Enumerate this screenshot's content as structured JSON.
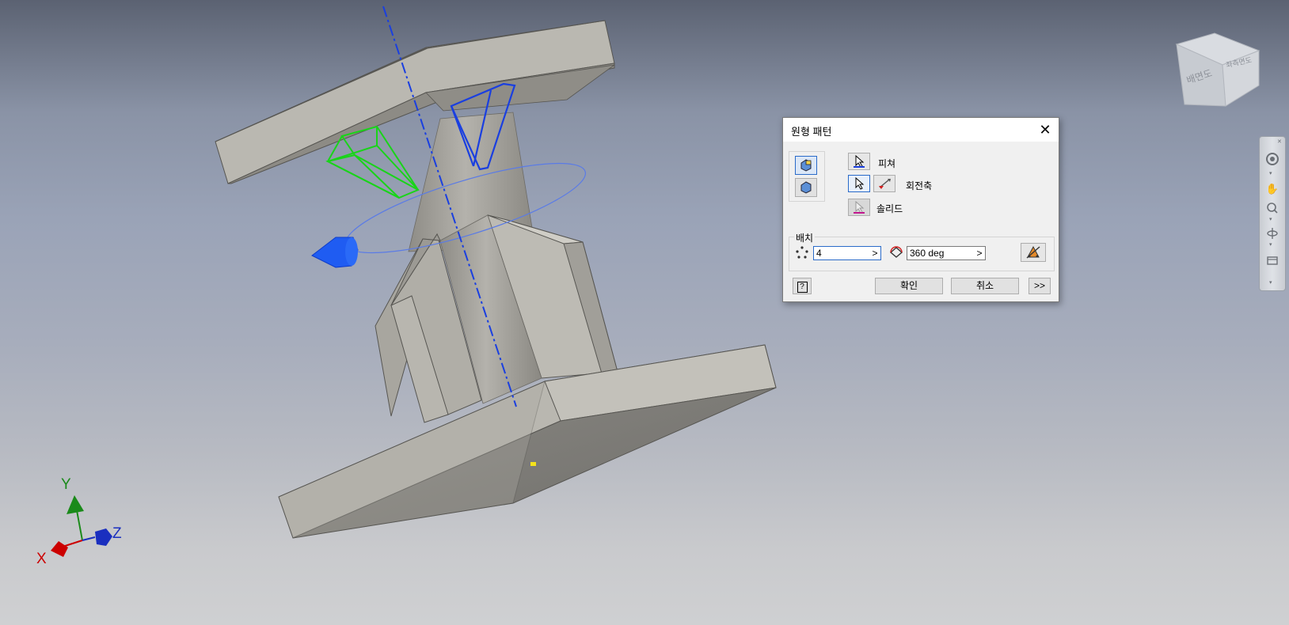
{
  "viewcube": {
    "face_front": "배면도",
    "face_right": "좌측면도"
  },
  "axes": {
    "x_label": "X",
    "y_label": "Y",
    "z_label": "Z",
    "x_color": "#cc0000",
    "y_color": "#1a8a1a",
    "z_color": "#1a2fbf"
  },
  "dialog": {
    "title": "원형 패턴",
    "close_glyph": "✕",
    "feature_label": "피쳐",
    "axis_label": "회전축",
    "solid_label": "솔리드",
    "placement_label": "배치",
    "count_value": "4",
    "angle_value": "360 deg",
    "ok_label": "확인",
    "cancel_label": "취소",
    "more_label": ">>",
    "help_glyph": "?",
    "arrow_glyph": ">"
  },
  "colors": {
    "selection_green": "#19d419",
    "selection_blue": "#1a3fe0",
    "axis_blue": "#1a3fe0",
    "part_face_light": "#b9b7b0",
    "part_face_mid": "#a6a49d",
    "part_face_dark": "#7d7b76"
  }
}
